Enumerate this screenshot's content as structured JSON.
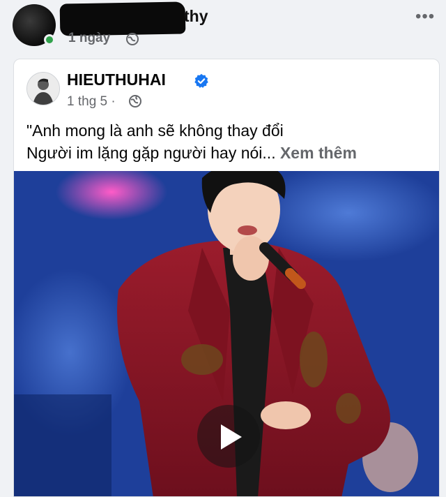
{
  "outer_post": {
    "author_visible_fragment": "thy",
    "time": "1 ngày",
    "more_icon": "more-dots-icon"
  },
  "shared_post": {
    "author": "HIEUTHUHAI",
    "verified_icon": "verified-badge-icon",
    "time": "1 thg 5 ·",
    "privacy_icon": "globe-icon",
    "caption_line1": "\"Anh mong là anh sẽ không thay đổi",
    "caption_line2": "Người im lặng gặp người hay nói...",
    "see_more": "Xem thêm"
  },
  "video": {
    "play_icon": "play-icon"
  },
  "colors": {
    "background": "#f0f2f5",
    "card": "#ffffff",
    "verified": "#1877f2",
    "secondary_text": "#65676b",
    "online": "#31a24c"
  }
}
